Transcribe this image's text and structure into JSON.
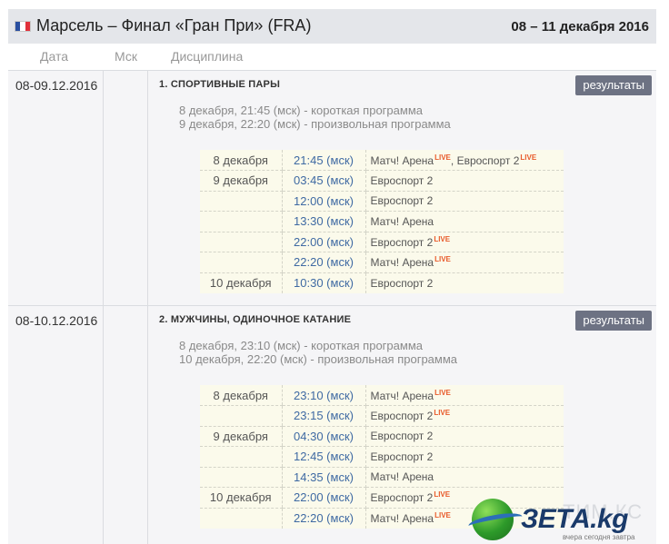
{
  "header": {
    "title": "Марсель – Финал «Гран При» (FRA)",
    "dates": "08 – 11 декабря 2016",
    "flag_colors": [
      "#2a4fa0",
      "#ffffff",
      "#e0303a"
    ]
  },
  "columns": {
    "date": "Дата",
    "msk": "Мск",
    "discipline": "Дисциплина"
  },
  "results_label": "результаты",
  "live_label": "LIVE",
  "events": [
    {
      "date": "08-09.12.2016",
      "title": "1. СПОРТИВНЫЕ ПАРЫ",
      "programs": [
        "8 декабря, 21:45 (мск) - короткая программа",
        "9 декабря, 22:20 (мск) - произвольная программа"
      ],
      "schedule": [
        {
          "day": "8 декабря",
          "time": "21:45 (мск)",
          "ch1": "Матч! Арена",
          "ch1_live": true,
          "ch2": "Евроспорт 2",
          "ch2_live": true
        },
        {
          "day": "9 декабря",
          "time": "03:45 (мск)",
          "ch1": "Евроспорт 2",
          "ch1_live": false
        },
        {
          "day": "",
          "time": "12:00 (мск)",
          "ch1": "Евроспорт 2",
          "ch1_live": false
        },
        {
          "day": "",
          "time": "13:30 (мск)",
          "ch1": "Матч! Арена",
          "ch1_live": false
        },
        {
          "day": "",
          "time": "22:00 (мск)",
          "ch1": "Евроспорт 2",
          "ch1_live": true
        },
        {
          "day": "",
          "time": "22:20 (мск)",
          "ch1": "Матч! Арена",
          "ch1_live": true
        },
        {
          "day": "10 декабря",
          "time": "10:30 (мск)",
          "ch1": "Евроспорт 2",
          "ch1_live": false
        }
      ]
    },
    {
      "date": "08-10.12.2016",
      "title": "2. МУЖЧИНЫ, ОДИНОЧНОЕ КАТАНИЕ",
      "programs": [
        "8 декабря, 23:10 (мск) - короткая программа",
        "10 декабря, 22:20 (мск) - произвольная программа"
      ],
      "schedule": [
        {
          "day": "8 декабря",
          "time": "23:10 (мск)",
          "ch1": "Матч! Арена",
          "ch1_live": true
        },
        {
          "day": "",
          "time": "23:15 (мск)",
          "ch1": "Евроспорт 2",
          "ch1_live": true
        },
        {
          "day": "9 декабря",
          "time": "04:30 (мск)",
          "ch1": "Евроспорт 2",
          "ch1_live": false
        },
        {
          "day": "",
          "time": "12:45 (мск)",
          "ch1": "Евроспорт 2",
          "ch1_live": false
        },
        {
          "day": "",
          "time": "14:35 (мск)",
          "ch1": "Матч! Арена",
          "ch1_live": false
        },
        {
          "day": "10 декабря",
          "time": "22:00 (мск)",
          "ch1": "Евроспорт 2",
          "ch1_live": true
        },
        {
          "day": "",
          "time": "22:20 (мск)",
          "ch1": "Матч! Арена",
          "ch1_live": true
        }
      ]
    }
  ],
  "watermark": {
    "faded": "ТИМ.КС",
    "brand": "ЗЕТА.kg",
    "tagline": "вчера сегодня завтра"
  }
}
